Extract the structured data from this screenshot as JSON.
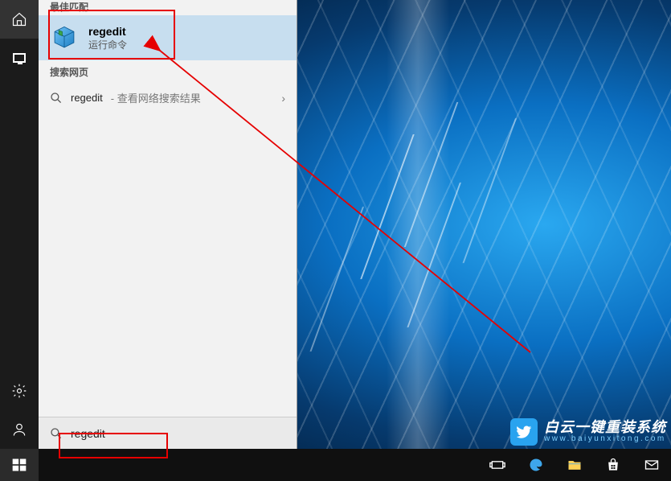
{
  "rail": {
    "home_label": "home-icon",
    "monitor_label": "this-pc-icon",
    "settings_label": "settings-icon",
    "account_label": "account-icon"
  },
  "panel": {
    "truncated_header": "最佳匹配",
    "best_match": {
      "title": "regedit",
      "subtitle": "运行命令"
    },
    "web_header": "搜索网页",
    "web_item": {
      "term": "regedit",
      "suffix": " - 查看网络搜索结果"
    },
    "search_value": "regedit"
  },
  "taskbar": {
    "icons": [
      "start",
      "taskview",
      "edge",
      "explorer",
      "store",
      "mail"
    ]
  },
  "watermark": {
    "line1": "白云一键重装系统",
    "line2": "www.baiyunxitong.com"
  },
  "colors": {
    "highlight_bg": "#c7deef",
    "annotation_red": "#e60000",
    "accent_blue": "#29a3ef"
  }
}
